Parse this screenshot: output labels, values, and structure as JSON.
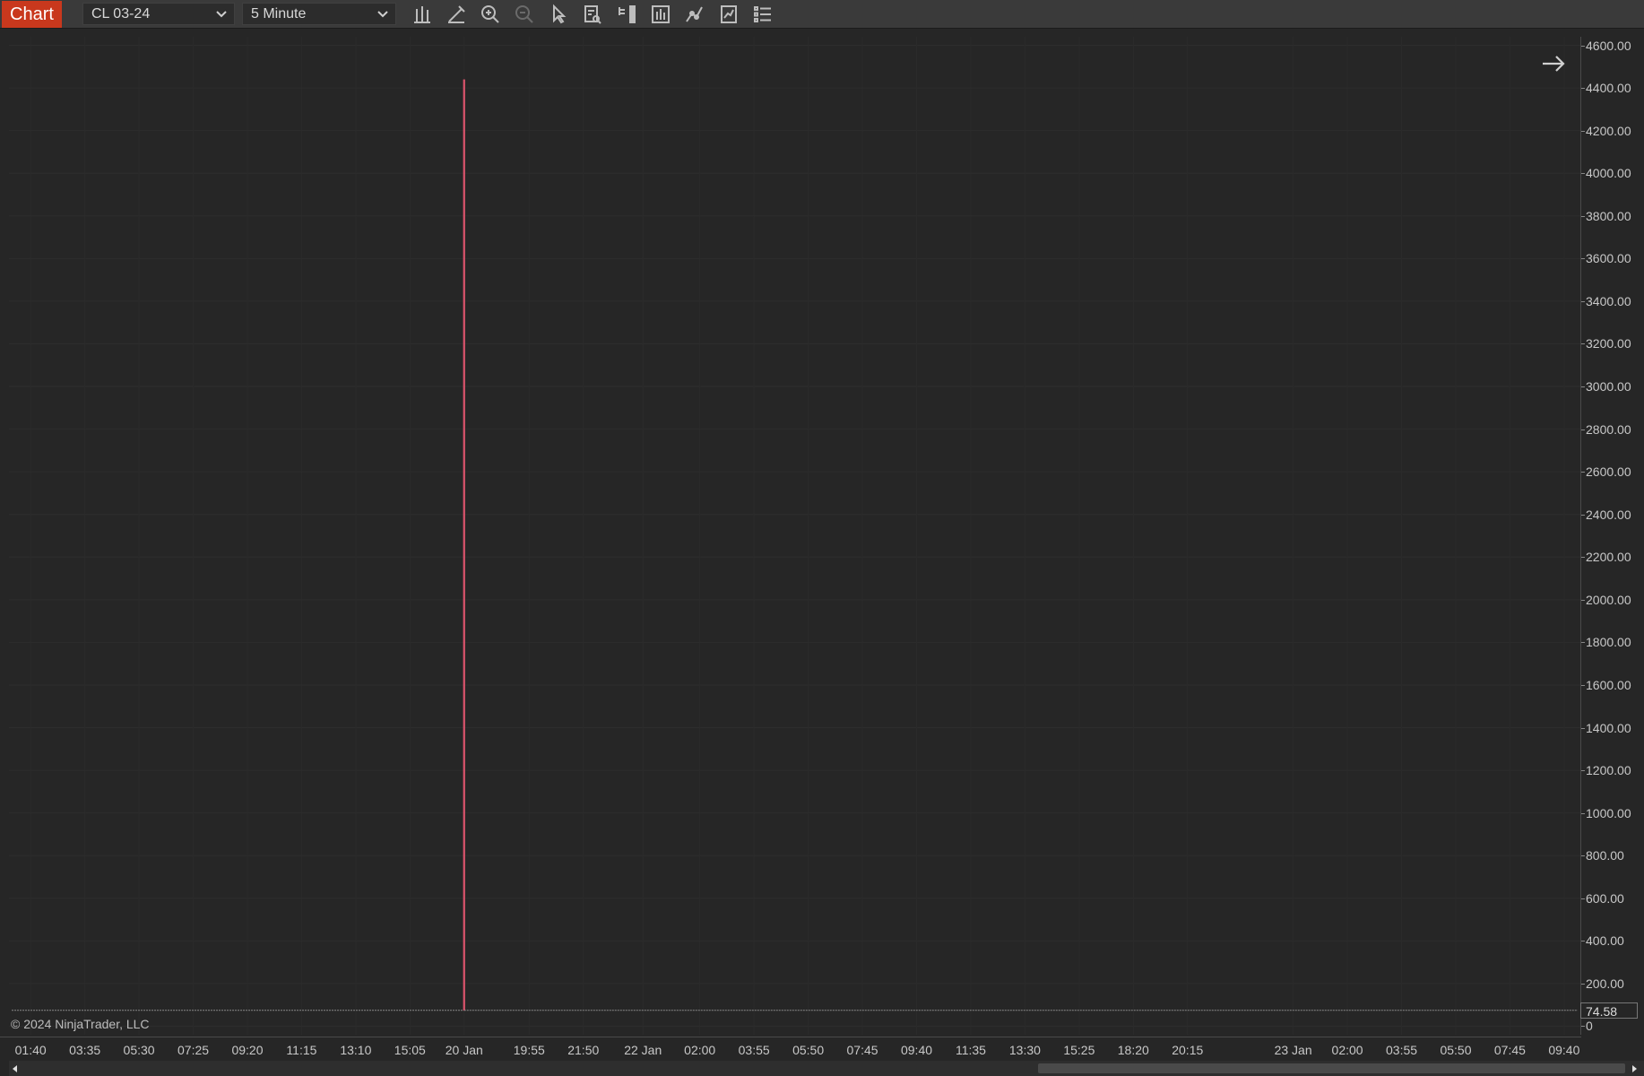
{
  "toolbar": {
    "tab_label": "Chart",
    "instrument": "CL 03-24",
    "interval": "5 Minute",
    "icons": [
      "bar-type-icon",
      "drawing-tool-icon",
      "zoom-in-icon",
      "zoom-out-icon",
      "pointer-icon",
      "data-box-icon",
      "chart-trader-icon",
      "data-series-icon",
      "indicators-icon",
      "strategies-icon",
      "properties-icon"
    ]
  },
  "copyright": "© 2024 NinjaTrader, LLC",
  "last_price": "74.58",
  "colors": {
    "tab": "#c9381d",
    "price_line": "#d9536b",
    "background": "#262626"
  },
  "chart_data": {
    "type": "line",
    "title": "",
    "xlabel": "",
    "ylabel": "",
    "ylim": [
      -40,
      4640
    ],
    "y_tick_labels": [
      "4600.00",
      "4400.00",
      "4200.00",
      "4000.00",
      "3800.00",
      "3600.00",
      "3400.00",
      "3200.00",
      "3000.00",
      "2800.00",
      "2600.00",
      "2400.00",
      "2200.00",
      "2000.00",
      "1800.00",
      "1600.00",
      "1400.00",
      "1200.00",
      "1000.00",
      "800.00",
      "600.00",
      "400.00",
      "200.00",
      "0"
    ],
    "x_tick_labels": [
      "01:40",
      "03:35",
      "05:30",
      "07:25",
      "09:20",
      "11:15",
      "13:10",
      "15:05",
      "20 Jan",
      "19:55",
      "21:50",
      "22 Jan",
      "02:00",
      "03:55",
      "05:50",
      "07:45",
      "09:40",
      "11:35",
      "13:30",
      "15:25",
      "18:20",
      "20:15",
      "23 Jan",
      "02:00",
      "03:55",
      "05:50",
      "07:45",
      "09:40"
    ],
    "x_tick_index": [
      0,
      1,
      2,
      3,
      4,
      5,
      6,
      7,
      8,
      9.2,
      10.2,
      11.3,
      12.35,
      13.35,
      14.35,
      15.35,
      16.35,
      17.35,
      18.35,
      19.35,
      20.35,
      21.35,
      23.3,
      24.3,
      25.3,
      26.3,
      27.3,
      28.3
    ],
    "x_span": [
      -0.4,
      28.6
    ],
    "series": [
      {
        "values": [
          [
            -0.35,
            74.6
          ],
          [
            8.0,
            74.6
          ],
          [
            8.0,
            4440
          ],
          [
            8.0,
            74.6
          ],
          [
            28.55,
            74.58
          ]
        ]
      }
    ],
    "grid": true,
    "last_value": 74.58
  }
}
